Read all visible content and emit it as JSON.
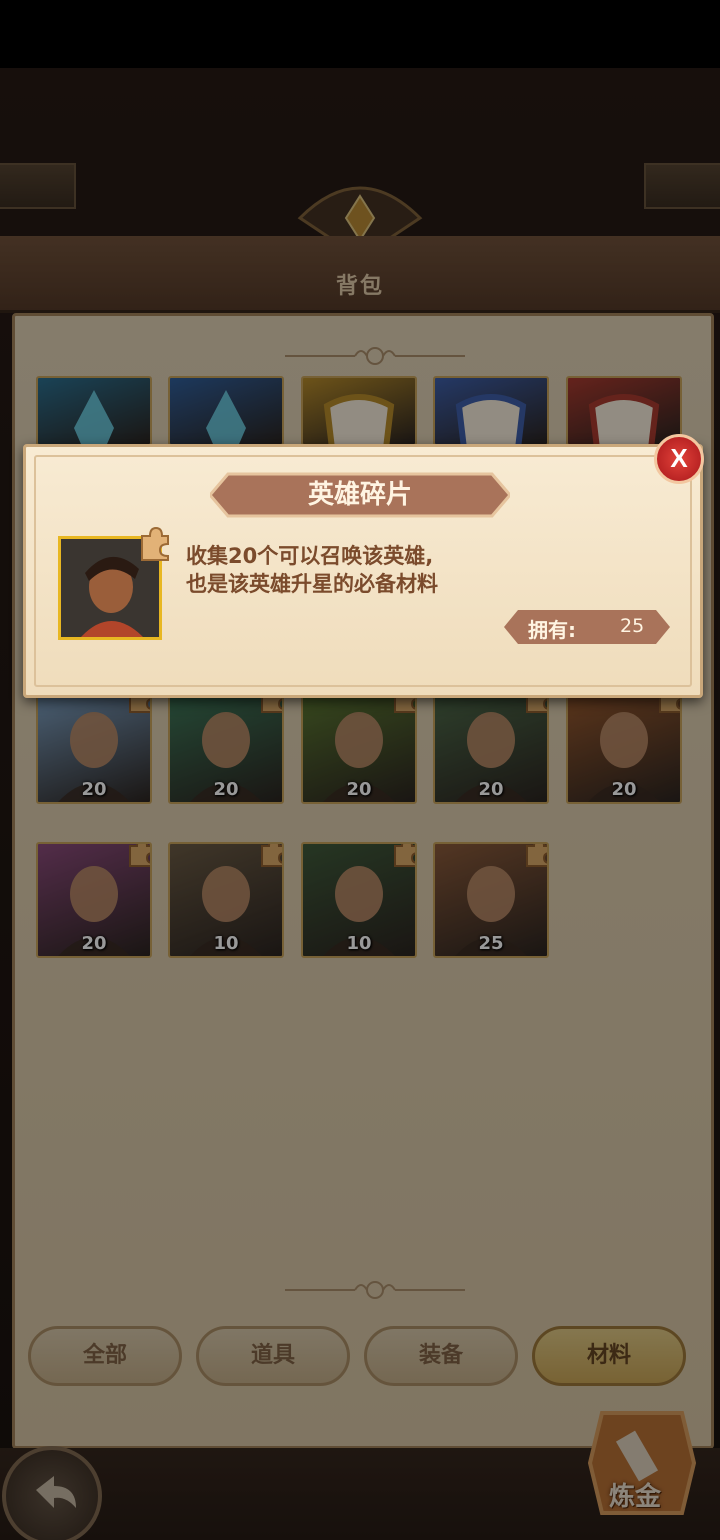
{
  "header": {
    "title": "背包"
  },
  "popup": {
    "title": "英雄碎片",
    "description_line1": "收集20个可以召唤该英雄,",
    "description_line2": "也是该英雄升星的必备材料",
    "owned_label": "拥有:",
    "owned_value": "25",
    "close_label": "X"
  },
  "inventory": {
    "row1": [
      {
        "icon": "blue-crystal",
        "color": "#2c6f8f"
      },
      {
        "icon": "blue-crystal",
        "color": "#2f5e9a"
      },
      {
        "icon": "gold-scroll",
        "color": "#b58a2a"
      },
      {
        "icon": "blue-scroll",
        "color": "#3d5ea8"
      },
      {
        "icon": "red-scroll",
        "color": "#a83a2f"
      }
    ],
    "row3": [
      {
        "icon": "elf-hero-portrait",
        "count": "20",
        "color": "#7fa3c6"
      },
      {
        "icon": "green-haired-elf-portrait",
        "count": "20",
        "color": "#3e7a5a"
      },
      {
        "icon": "orc-shaman-portrait",
        "count": "20",
        "color": "#5d7a32"
      },
      {
        "icon": "goblin-warrior-portrait",
        "count": "20",
        "color": "#4e6b4a"
      },
      {
        "icon": "dwarf-portrait",
        "count": "20",
        "color": "#9a5a2e"
      }
    ],
    "row4": [
      {
        "icon": "pink-haired-engineer-portrait",
        "count": "20",
        "color": "#8a4a7a"
      },
      {
        "icon": "bearded-knight-portrait",
        "count": "10",
        "color": "#6a5a44"
      },
      {
        "icon": "orc-woman-portrait",
        "count": "10",
        "color": "#3f5a3a"
      },
      {
        "icon": "young-warrior-portrait",
        "count": "25",
        "color": "#8a5a3a"
      }
    ]
  },
  "tabs": [
    {
      "label": "全部"
    },
    {
      "label": "道具"
    },
    {
      "label": "装备"
    },
    {
      "label": "材料"
    }
  ],
  "alchemy": {
    "label": "炼金"
  },
  "colors": {
    "accent_gold": "#e8b722",
    "close_red": "#c92a2a",
    "banner_brown": "#a9735a"
  }
}
